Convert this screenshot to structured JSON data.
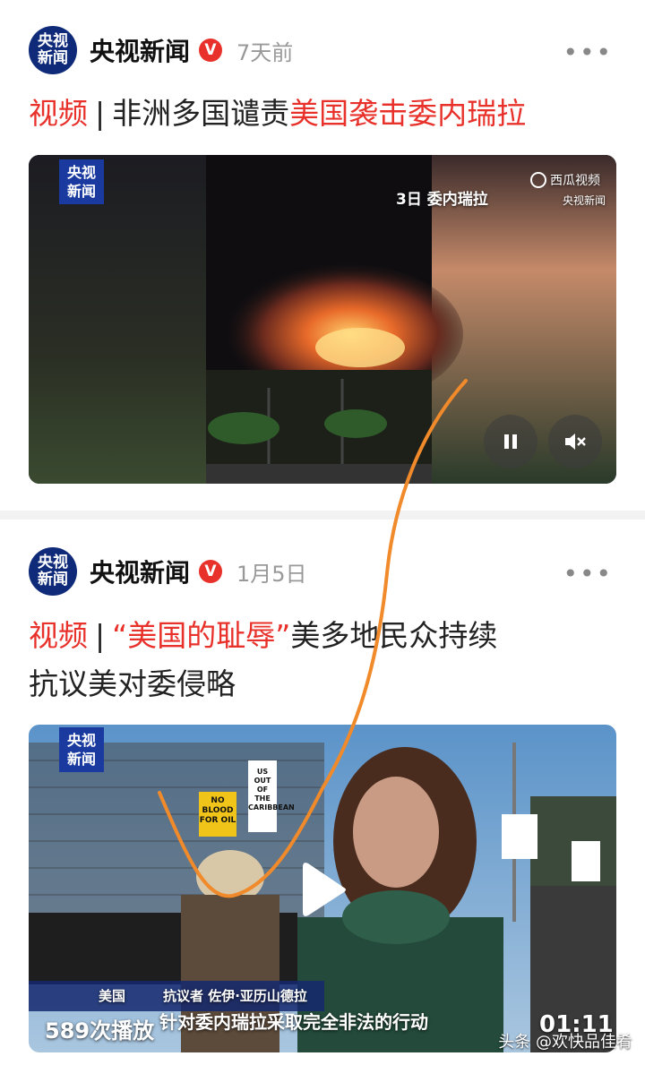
{
  "posts": [
    {
      "author": "央视新闻",
      "avatar_line1": "央视",
      "avatar_line2": "新闻",
      "time": "7天前",
      "title_tag": "视频",
      "title_sep": "|",
      "title_plain": "非洲多国谴责",
      "title_highlight": "美国袭击委内瑞拉",
      "video": {
        "logo_line1": "央视",
        "logo_line2": "新闻",
        "source_name": "西瓜视频",
        "source_sub": "央视新闻",
        "caption": "3日  委内瑞拉"
      }
    },
    {
      "author": "央视新闻",
      "avatar_line1": "央视",
      "avatar_line2": "新闻",
      "time": "1月5日",
      "title_tag": "视频",
      "title_sep": "|",
      "title_quote": "“美国的耻辱”",
      "title_rest_line1": "美多地民众持续",
      "title_rest_line2": "抗议美对委侵略",
      "video": {
        "logo_line1": "央视",
        "logo_line2": "新闻",
        "plays": "589次播放",
        "duration": "01:11",
        "lower_left": "美国",
        "lower_name": "抗议者 佐伊·亚历山德拉",
        "subtitle": "针对委内瑞拉采取完全非法的行动",
        "sign_no_blood": "NO BLOOD FOR OIL",
        "sign_us_out": "US OUT OF THE CARIBBEAN"
      }
    }
  ],
  "watermark": "头条 @欢快品佳肴",
  "more_icon": "•••",
  "verified_icon": "V"
}
